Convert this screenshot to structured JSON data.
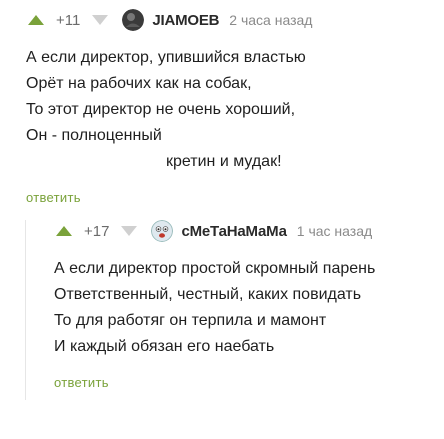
{
  "comments": [
    {
      "score": "+11",
      "author": "JIAMOEB",
      "time": "2 часа назад",
      "lines": [
        "А если директор, упившийся властью",
        "Орёт на рабочих как на собак,",
        "То этот директор не очень хороший,",
        "Он - полноценный",
        "кретин и мудак!"
      ],
      "reply_label": "ответить"
    },
    {
      "score": "+17",
      "author": "сМеТаНаМаМа",
      "time": "1 час назад",
      "lines": [
        "А если директор простой скромный парень",
        "Ответственный, честный, каких повидать",
        "То для работяг он терпила и мамонт",
        "И каждый обязан его наебать"
      ],
      "reply_label": "ответить"
    }
  ],
  "colors": {
    "upvote": "#7aa23a",
    "downvote": "#d0d0d0",
    "reply": "#7aa23a"
  },
  "icons": {
    "upvote": "upvote-icon",
    "downvote": "downvote-icon",
    "avatar1": "dark-avatar",
    "avatar2": "cartoon-face-avatar"
  }
}
